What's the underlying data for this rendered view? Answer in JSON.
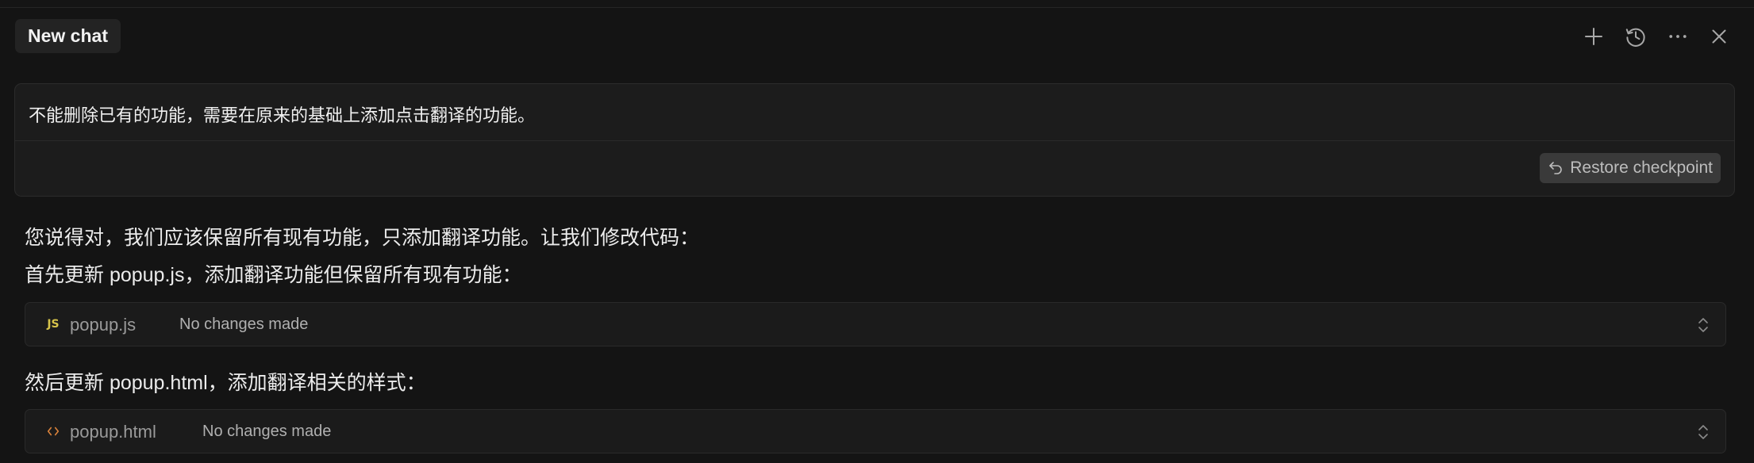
{
  "header": {
    "title": "New chat",
    "icons": [
      "plus-icon",
      "history-icon",
      "more-icon",
      "close-icon"
    ]
  },
  "user_message": {
    "text": "不能删除已有的功能，需要在原来的基础上添加点击翻译的功能。",
    "restore_label": "Restore checkpoint"
  },
  "response": {
    "line1": "您说得对，我们应该保留所有现有功能，只添加翻译功能。让我们修改代码：",
    "line2": "首先更新 popup.js，添加翻译功能但保留所有现有功能：",
    "file1": {
      "icon": "JS",
      "name": "popup.js",
      "status": "No changes made"
    },
    "line3": "然后更新 popup.html，添加翻译相关的样式：",
    "file2": {
      "icon": "code-icon",
      "name": "popup.html",
      "status": "No changes made"
    }
  },
  "colors": {
    "background": "#141414",
    "card": "#1b1b1b",
    "js_badge": "#d6c34a",
    "html_icon": "#d9823b"
  }
}
